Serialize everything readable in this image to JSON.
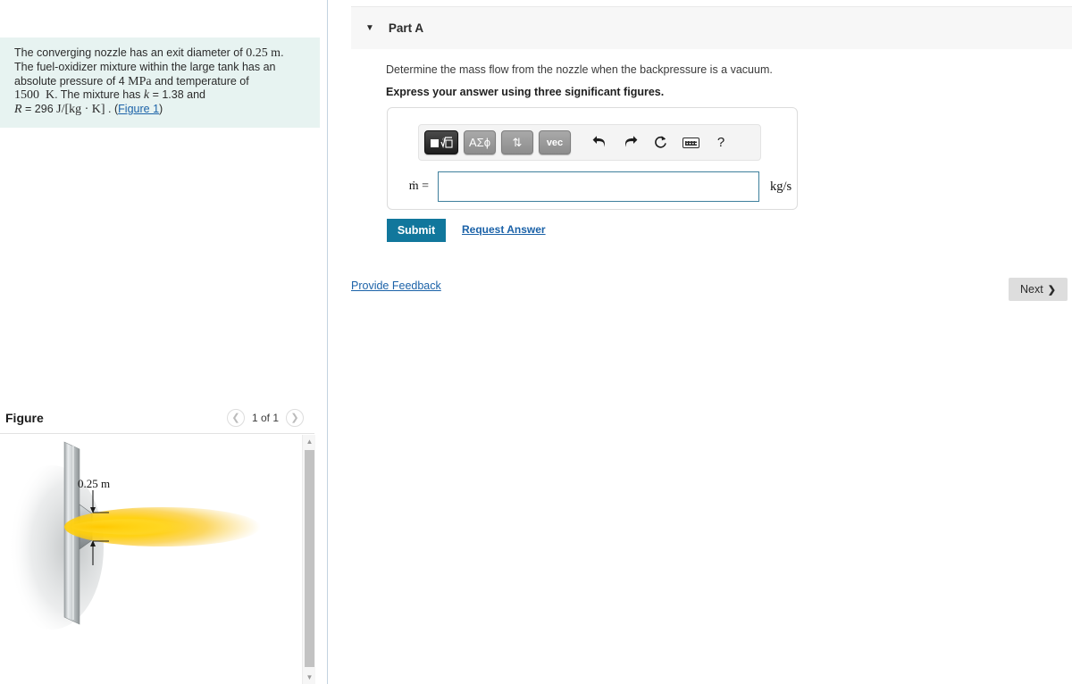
{
  "problem": {
    "line1_a": "The converging nozzle has an exit diameter of ",
    "line1_val": "0.25",
    "line1_unit": "m",
    "line1_end": ".",
    "line2": "The fuel-oxidizer mixture within the large tank has an",
    "line3_a": "absolute pressure of 4 ",
    "line3_unit": "MPa",
    "line3_b": " and temperature of",
    "line4_val": "1500",
    "line4_unit": "K",
    "line4_b": ". The mixture has ",
    "line4_sym": "k",
    "line4_c": " = 1.38 and",
    "line5_sym": "R",
    "line5_eq": " = 296 ",
    "line5_unit": "J/[kg · K]",
    "line5_dot": " . (",
    "line5_link": "Figure 1",
    "line5_close": ")"
  },
  "figure": {
    "title": "Figure",
    "prev_icon": "chevron-left",
    "next_icon": "chevron-right",
    "counter": "1 of 1",
    "dimension_label": "0.25 m"
  },
  "part": {
    "caret": "▼",
    "label": "Part A",
    "question": "Determine the mass flow from the nozzle when the backpressure is a vacuum.",
    "instruction": "Express your answer using three significant figures."
  },
  "mathbar": {
    "buttons": [
      {
        "name": "math-template-button",
        "label": "⬜√□",
        "active": true
      },
      {
        "name": "greek-letters-button",
        "label": "ΑΣϕ",
        "active": false
      },
      {
        "name": "updown-arrows-button",
        "label": "⇅",
        "active": false
      },
      {
        "name": "vector-button",
        "label": "vec",
        "active": false
      }
    ],
    "icons": [
      {
        "name": "undo-icon",
        "glyph": "↶"
      },
      {
        "name": "redo-icon",
        "glyph": "↷"
      },
      {
        "name": "reset-icon",
        "glyph": "↺"
      },
      {
        "name": "keyboard-icon",
        "glyph": ""
      },
      {
        "name": "help-icon",
        "glyph": "?"
      }
    ]
  },
  "answer": {
    "label": "ṁ =",
    "value": "",
    "placeholder": "",
    "unit": "kg/s"
  },
  "actions": {
    "submit": "Submit",
    "request_answer": "Request Answer",
    "provide_feedback": "Provide Feedback",
    "next": "Next",
    "next_chevron": "❯"
  },
  "scrollbar": {
    "up_arrow": "▲",
    "down_arrow": "▼"
  },
  "colors": {
    "problem_bg": "#e7f3f1",
    "submit_bg": "#11779c",
    "link": "#1b62a8",
    "input_border": "#3e7f9c",
    "next_bg": "#dddddd",
    "flame_core": "#ffd400",
    "flame_edge": "#f5a800"
  }
}
